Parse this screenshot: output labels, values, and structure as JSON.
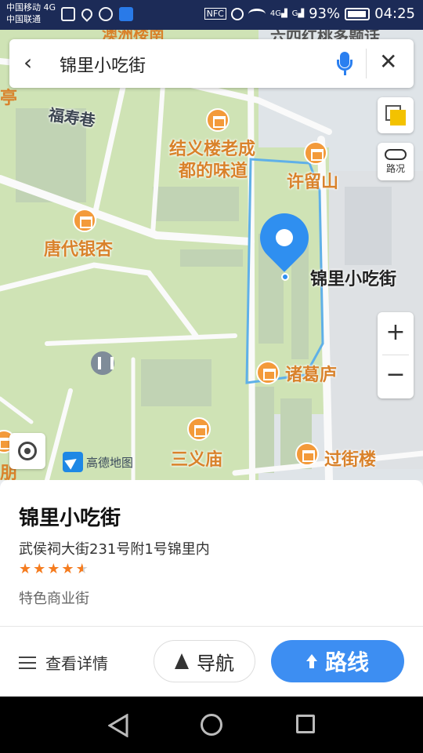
{
  "status_bar": {
    "carrier1": "中国移动 4G",
    "carrier2": "中国联通",
    "battery": "93%",
    "time": "04:25"
  },
  "search": {
    "query": "锦里小吃街"
  },
  "map": {
    "traffic_label": "路况",
    "brand": "高德地图",
    "labels": {
      "fushou": "福寿巷",
      "jieyi1": "结义楼老成",
      "jieyi2": "都的味道",
      "xuliu": "许留山",
      "tangdai": "唐代银杏",
      "jinli": "锦里小吃街",
      "zhuge": "诸葛庐",
      "sanyi": "三义庙",
      "guojie": "过街楼"
    },
    "icons": {
      "layers": "layers-icon",
      "traffic": "traffic-icon",
      "zoom_in": "plus-icon",
      "zoom_out": "minus-icon",
      "locate": "locate-icon",
      "pin": "location-pin-icon"
    }
  },
  "place": {
    "title": "锦里小吃街",
    "address": "武侯祠大街231号附1号锦里内",
    "rating": 4.5,
    "category": "特色商业街"
  },
  "actions": {
    "details": "查看详情",
    "navigate": "导航",
    "route": "路线"
  },
  "colors": {
    "accent": "#3d8ef2",
    "poi": "#d9822b",
    "status_bar": "#1c2b57"
  }
}
